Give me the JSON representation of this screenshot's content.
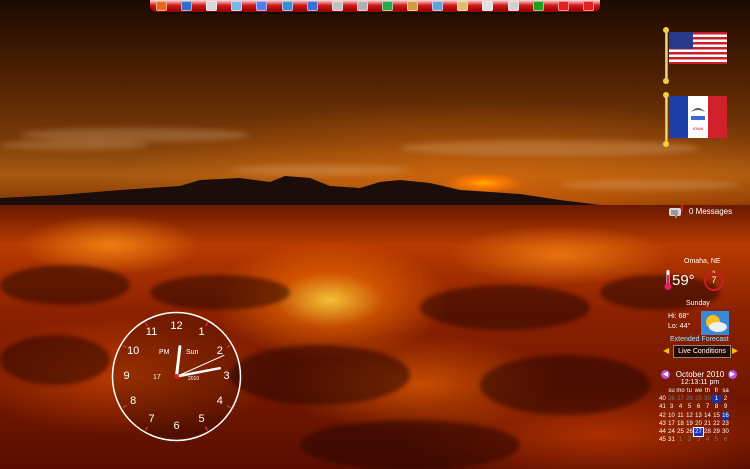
{
  "toolbar": {
    "icons": [
      {
        "name": "firefox-icon",
        "color": "#e8671a"
      },
      {
        "name": "globe-icon",
        "color": "#2e6fc8"
      },
      {
        "name": "document-icon",
        "color": "#d8d8d8"
      },
      {
        "name": "notes-icon",
        "color": "#7ab8e8"
      },
      {
        "name": "recycle-icon",
        "color": "#5a7ae8"
      },
      {
        "name": "network-icon",
        "color": "#3a90d8"
      },
      {
        "name": "ie-icon",
        "color": "#3a70d8"
      },
      {
        "name": "tools-icon",
        "color": "#c0c0c0"
      },
      {
        "name": "pen-icon",
        "color": "#b0b0b0"
      },
      {
        "name": "skype-icon",
        "color": "#2ea84a"
      },
      {
        "name": "key-icon",
        "color": "#c8a040"
      },
      {
        "name": "network-folder-icon",
        "color": "#6aa0d8"
      },
      {
        "name": "user-folder-icon",
        "color": "#d8c070"
      },
      {
        "name": "keyboard-icon",
        "color": "#e0e0e0"
      },
      {
        "name": "cut-icon",
        "color": "#d0d0d0"
      },
      {
        "name": "greenball-icon",
        "color": "#20a020"
      },
      {
        "name": "power-icon",
        "color": "#e02020"
      },
      {
        "name": "block-icon",
        "color": "#e02020"
      }
    ]
  },
  "messages": {
    "label": "0 Messages"
  },
  "weather": {
    "city": "Omaha, NE",
    "temperature": "59°",
    "compass_value": "7",
    "day": "Sunday",
    "high": "Hi: 68°",
    "low": "Lo: 44°",
    "extended_label": "Extended Forecast",
    "live_label": "Live Conditions"
  },
  "calendar": {
    "month_title": "October 2010",
    "time": "12:13:11 pm",
    "weekday_headers": [
      "su",
      "mo",
      "tu",
      "we",
      "th",
      "fr",
      "sa"
    ],
    "weeks": [
      {
        "week": "40",
        "days": [
          [
            "26",
            "other"
          ],
          [
            "27",
            "other"
          ],
          [
            "28",
            "other"
          ],
          [
            "29",
            "other"
          ],
          [
            "30",
            "other"
          ],
          [
            "1",
            "hl"
          ],
          [
            "2",
            "day"
          ]
        ]
      },
      {
        "week": "41",
        "days": [
          [
            "3",
            "day"
          ],
          [
            "4",
            "day"
          ],
          [
            "5",
            "day"
          ],
          [
            "6",
            "day"
          ],
          [
            "7",
            "day"
          ],
          [
            "8",
            "day"
          ],
          [
            "9",
            "day"
          ]
        ]
      },
      {
        "week": "42",
        "days": [
          [
            "10",
            "day"
          ],
          [
            "11",
            "day"
          ],
          [
            "12",
            "day"
          ],
          [
            "13",
            "day"
          ],
          [
            "14",
            "day"
          ],
          [
            "15",
            "day"
          ],
          [
            "16",
            "hl"
          ]
        ]
      },
      {
        "week": "43",
        "days": [
          [
            "17",
            "day"
          ],
          [
            "18",
            "day"
          ],
          [
            "19",
            "day"
          ],
          [
            "20",
            "day"
          ],
          [
            "21",
            "day"
          ],
          [
            "22",
            "day"
          ],
          [
            "23",
            "day"
          ]
        ]
      },
      {
        "week": "44",
        "days": [
          [
            "24",
            "day"
          ],
          [
            "25",
            "day"
          ],
          [
            "26",
            "day"
          ],
          [
            "27",
            "today"
          ],
          [
            "28",
            "day"
          ],
          [
            "29",
            "day"
          ],
          [
            "30",
            "day"
          ]
        ]
      },
      {
        "week": "45",
        "days": [
          [
            "31",
            "day"
          ],
          [
            "1",
            "other"
          ],
          [
            "2",
            "other"
          ],
          [
            "3",
            "other"
          ],
          [
            "4",
            "other"
          ],
          [
            "5",
            "other"
          ],
          [
            "6",
            "other"
          ]
        ]
      }
    ]
  },
  "clock": {
    "numerals": [
      "12",
      "1",
      "2",
      "3",
      "4",
      "5",
      "6",
      "7",
      "8",
      "9",
      "10",
      "11"
    ],
    "ampm": "PM",
    "weekday": "Sun",
    "date": "17",
    "year": "2010",
    "hour": 12,
    "minute": 13,
    "second": 11
  },
  "colors": {
    "toolbar": "#d01818",
    "accent_highlight": "#1b2e9a"
  }
}
